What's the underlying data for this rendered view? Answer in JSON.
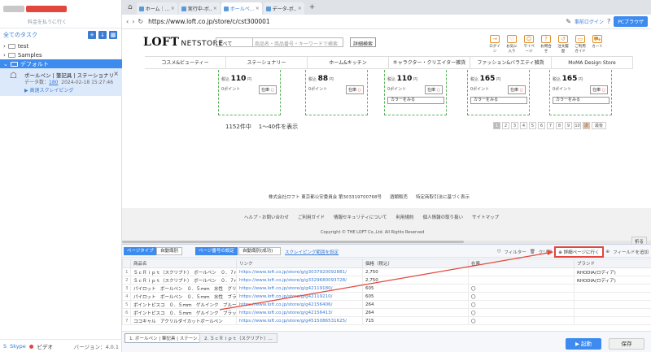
{
  "sidebar": {
    "up_link": "料金を払うに行く",
    "tasks_header": "全てのタスク",
    "tree": [
      {
        "label": "test"
      },
      {
        "label": "Samples"
      },
      {
        "label": "デフォルト"
      }
    ],
    "task": {
      "title": "ボールペン | 筆記具 | ステーショナリー | ...",
      "data_label": "データ数：",
      "data_count": "180",
      "date": "2024-02-18 15:27:46",
      "status": "高速スクレイピング"
    },
    "footer": {
      "skype": "Skype",
      "video": "ビデオ",
      "version": "バージョン：4.0.1"
    }
  },
  "browser": {
    "tabs": [
      {
        "label": "ホーム｜..."
      },
      {
        "label": "実行中-ボ..."
      },
      {
        "label": "ボールペ..."
      },
      {
        "label": "データ-ボ..."
      }
    ],
    "url": "https://www.loft.co.jp/store/c/cst300001",
    "login_label": "事前ログイン",
    "pc_browser": "PCブラウザ"
  },
  "site": {
    "logo": "LOFT",
    "logo_sub": "NETSTORE",
    "search_select": "すべて",
    "search_placeholder": "商品名・商品番号・キーワードで検索",
    "detail_search": "詳細検索",
    "header_icons": [
      {
        "icon": "login-icon",
        "label": "ログイン"
      },
      {
        "icon": "favorite-icon",
        "label": "お気に入り"
      },
      {
        "icon": "mypage-icon",
        "label": "マイページ"
      },
      {
        "icon": "help-icon",
        "label": "お問合せ"
      },
      {
        "icon": "history-icon",
        "label": "注文履歴"
      },
      {
        "icon": "card-icon",
        "label": "ご利用ガイド"
      },
      {
        "icon": "cart-icon",
        "label": "カート"
      }
    ],
    "categories": [
      "コスメ&ビューティー",
      "ステーショナリー",
      "ホーム&キッチン",
      "キャラクター・クリエイター雑貨",
      "ファッション&バラエティ雑貨",
      "MoMA Design Store"
    ],
    "cards": [
      {
        "tax": "税込",
        "price": "110",
        "yen": "円",
        "point": "0ポイント",
        "stock": "在庫",
        "color": ""
      },
      {
        "tax": "税込",
        "price": "88",
        "yen": "円",
        "point": "0ポイント",
        "stock": "在庫",
        "color": ""
      },
      {
        "tax": "税込",
        "price": "110",
        "yen": "円",
        "point": "0ポイント",
        "stock": "在庫",
        "color": "カラーをみる"
      },
      {
        "tax": "税込",
        "price": "165",
        "yen": "円",
        "point": "0ポイント",
        "stock": "在庫",
        "color": "カラーをみる"
      },
      {
        "tax": "税込",
        "price": "165",
        "yen": "円",
        "point": "0ポイント",
        "stock": "在庫",
        "color": "カラーをみる"
      }
    ],
    "count_total": "1152件中",
    "count_range": "1〜40件を表示",
    "pages": [
      "1",
      "2",
      "3",
      "4",
      "5",
      "6",
      "7",
      "8",
      "9",
      "10",
      "次"
    ],
    "pager_last": "最後",
    "footer_info": [
      "株式会社ロフト 東京都公安委員会 第303319700768号",
      "酒類販売",
      "特定商取引法に基づく表示"
    ],
    "footer_links": [
      "ヘルプ・お問い合わせ",
      "ご利用ガイド",
      "情報セキュリティについて",
      "利用規約",
      "個人情報の取り扱い",
      "サイトマップ"
    ],
    "copyright": "Copyright © THE LOFT Co.,Ltd. All Rights Reserved"
  },
  "panel": {
    "fold": "折る",
    "page_type_label": "ページタイプ",
    "page_type_value": "自動識別",
    "page_count_label": "ページ番号の設定",
    "page_count_value": "自動識別(成功)",
    "scraping_range_link": "スクレイピング範囲を設定",
    "filter": "フィルター",
    "clear": "クリア",
    "go_detail": "詳細ページに行く",
    "add_field": "フィールドを追加"
  },
  "table": {
    "headers": [
      "",
      "商品名",
      "リンク",
      "価格（税込）",
      "在庫",
      "ブランド"
    ],
    "rows": [
      [
        "1",
        "ＳｃＲｉｐｔ（スクリプト）　ボールペン　０．７ｍｍ　１本",
        "https://www.loft.co.jp/store/g/g3037920092881/",
        "2,750",
        "",
        "RHODIA(ロディア)"
      ],
      [
        "2",
        "ＳｃＲｉｐｔ（スクリプト）　ボールペン　０．７ｍｍ　１本",
        "https://www.loft.co.jp/store/g/g3329680093728/",
        "2,750",
        "",
        "RHODIA(ロディア)"
      ],
      [
        "3",
        "パイロット　ボールペン　０．５ｍｍ　水性　グリーン",
        "https://www.loft.co.jp/store/g/g42119180/",
        "605",
        "〇",
        ""
      ],
      [
        "4",
        "パイロット　ボールペン　０．５ｍｍ　水性　ブラック",
        "https://www.loft.co.jp/store/g/g42119210/",
        "605",
        "〇",
        ""
      ],
      [
        "5",
        "ポイントピスコ　０．５ｍｍ　ゲルインク　ブルー",
        "https://www.loft.co.jp/store/g/g42156406/",
        "264",
        "〇",
        ""
      ],
      [
        "6",
        "ポイントピスコ　０．５ｍｍ　ゲルインク　ブラック",
        "https://www.loft.co.jp/store/g/g42156413/",
        "264",
        "〇",
        ""
      ],
      [
        "7",
        "ココキャル　アクリルダイカットボールペン",
        "https://www.loft.co.jp/store/g/g4515086531625/",
        "715",
        "〇",
        ""
      ]
    ]
  },
  "bottom": {
    "tabs": [
      "1. ボールペン | 筆記具 | ステーシ...",
      "2. ＳｃＲｉｐｔ（スクリプト）..."
    ],
    "start": "起動",
    "save": "保存"
  },
  "colors": {
    "accent": "#3d8bef",
    "highlight": "#e2463c",
    "card_border": "#5bb55b"
  }
}
